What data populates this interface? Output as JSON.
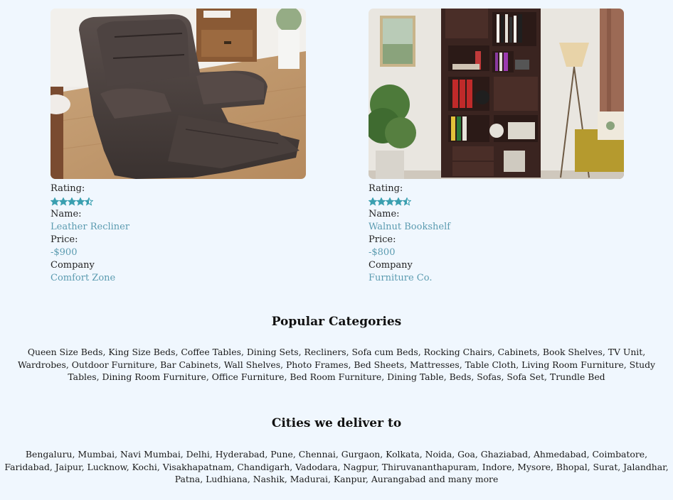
{
  "products": [
    {
      "image": "recliner-photo",
      "rating_label": "Rating:",
      "rating": 4.5,
      "name_label": "Name:",
      "name": "Leather Recliner",
      "price_label": "Price:",
      "price": "-$900",
      "company_label": "Company",
      "company": "Comfort Zone"
    },
    {
      "image": "bookshelf-photo",
      "rating_label": "Rating:",
      "rating": 4.5,
      "name_label": "Name:",
      "name": "Walnut Bookshelf",
      "price_label": "Price:",
      "price": "-$800",
      "company_label": "Company",
      "company": "Furniture Co."
    }
  ],
  "colors": {
    "background": "#f0f7fe",
    "accent": "#5b9bb0",
    "star": "#3a9fb0"
  },
  "popular_categories": {
    "title": "Popular Categories",
    "text": "Queen Size Beds, King Size Beds, Coffee Tables, Dining Sets, Recliners, Sofa cum Beds, Rocking Chairs, Cabinets, Book Shelves, TV Unit, Wardrobes, Outdoor Furniture, Bar Cabinets, Wall Shelves, Photo Frames, Bed Sheets, Mattresses, Table Cloth, Living Room Furniture, Study Tables, Dining Room Furniture, Office Furniture, Bed Room Furniture, Dining Table, Beds, Sofas, Sofa Set, Trundle Bed"
  },
  "cities": {
    "title": "Cities we deliver to",
    "text": "Bengaluru, Mumbai, Navi Mumbai, Delhi, Hyderabad, Pune, Chennai, Gurgaon, Kolkata, Noida, Goa, Ghaziabad, Ahmedabad, Coimbatore, Faridabad, Jaipur, Lucknow, Kochi, Visakhapatnam, Chandigarh, Vadodara, Nagpur, Thiruvananthapuram, Indore, Mysore, Bhopal, Surat, Jalandhar, Patna, Ludhiana, Nashik, Madurai, Kanpur, Aurangabad and many more"
  }
}
